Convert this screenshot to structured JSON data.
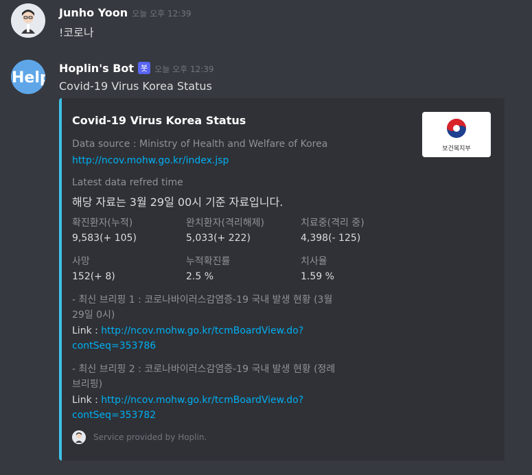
{
  "messages": [
    {
      "author": "Junho Yoon",
      "timestamp": "오늘 오후 12:39",
      "content": "!코로나"
    },
    {
      "author": "Hoplin's Bot",
      "badge": "봇",
      "timestamp": "오늘 오후 12:39",
      "content": "Covid-19 Virus Korea Status"
    }
  ],
  "embed": {
    "accent_color": "#3fc1e6",
    "title": "Covid-19 Virus Korea Status",
    "thumbnail_label": "보건복지부",
    "source_label": "Data source : Ministry of Health and Welfare of Korea",
    "source_url": "http://ncov.mohw.go.kr/index.jsp",
    "refresh_label": "Latest data refred time",
    "refresh_value": "해당 자료는 3월 29일 00시 기준 자료입니다.",
    "fields": [
      {
        "name": "확진환자(누적)",
        "value": "9,583(+ 105)"
      },
      {
        "name": "완치환자(격리해제)",
        "value": "5,033(+ 222)"
      },
      {
        "name": "치료중(격리 중)",
        "value": "4,398(- 125)"
      },
      {
        "name": "사망",
        "value": "152(+ 8)"
      },
      {
        "name": "누적확진률",
        "value": "2.5 %"
      },
      {
        "name": "치사율",
        "value": "1.59 %"
      }
    ],
    "briefings": [
      {
        "title_line1": "- 최신 브리핑 1 : 코로나바이러스감염증-19 국내 발생 현황 (3월",
        "title_line2": "29일 0시)",
        "link_prefix": "Link : ",
        "link_line1": "http://ncov.mohw.go.kr/tcmBoardView.do?",
        "link_line2": "contSeq=353786"
      },
      {
        "title_line1": "- 최신 브리핑 2 : 코로나바이러스감염증-19 국내 발생 현황 (정례",
        "title_line2": "브리핑)",
        "link_prefix": "Link : ",
        "link_line1": "http://ncov.mohw.go.kr/tcmBoardView.do?",
        "link_line2": "contSeq=353782"
      }
    ],
    "footer": "Service provided by Hoplin."
  }
}
